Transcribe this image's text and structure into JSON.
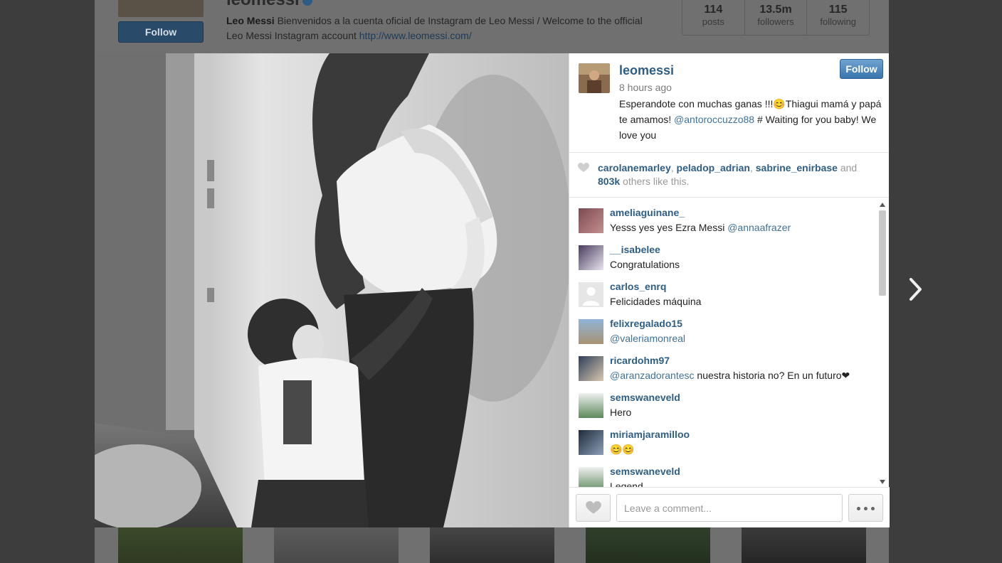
{
  "background_profile": {
    "username": "leomessi",
    "follow_label": "Follow",
    "bio_name": "Leo Messi",
    "bio_text": "Bienvenidos a la cuenta oficial de Instagram de Leo Messi / Welcome to the official Leo Messi Instagram account",
    "bio_link": "http://www.leomessi.com/",
    "stats": [
      {
        "value": "114",
        "label": "posts"
      },
      {
        "value": "13.5m",
        "label": "followers"
      },
      {
        "value": "115",
        "label": "following"
      }
    ]
  },
  "post": {
    "owner": "leomessi",
    "follow_label": "Follow",
    "time": "8 hours ago",
    "caption_part1": "Esperandote con muchas ganas !!!😊Thiagui mamá y papá te amamos!",
    "caption_mention": "@antoroccuzzo88",
    "caption_part2": "# Waiting for you baby! We love you",
    "likers": [
      "carolanemarley",
      "peladop_adrian",
      "sabrine_enirbase"
    ],
    "likes_and": "and",
    "likes_count": "803k",
    "likes_suffix": "others like this."
  },
  "comments": [
    {
      "user": "ameliaguinane_",
      "text": "Yesss yes yes Ezra Messi",
      "mention": "@annaafrazer"
    },
    {
      "user": "__isabelee",
      "text": "Congratulations",
      "mention": ""
    },
    {
      "user": "carlos_enrq",
      "text": "Felicidades máquina",
      "mention": ""
    },
    {
      "user": "felixregalado15",
      "text": "",
      "mention": "@valeriamonreal"
    },
    {
      "user": "ricardohm97",
      "text": "nuestra historia no? En un futuro❤",
      "mention": "@aranzadorantesc"
    },
    {
      "user": "semswaneveld",
      "text": "Hero",
      "mention": ""
    },
    {
      "user": "miriamjaramilloo",
      "text": "😊😊",
      "mention": ""
    },
    {
      "user": "semswaneveld",
      "text": "Legend",
      "mention": ""
    }
  ],
  "comment_bar": {
    "placeholder": "Leave a comment..."
  },
  "icons": {
    "heart": "heart-icon",
    "more": "more-options-icon",
    "next": "chevron-right-icon",
    "verified": "verified-badge-icon"
  },
  "colors": {
    "link": "#2e5e86",
    "mention": "#3f729b",
    "follow_button": "#3a75ae"
  }
}
